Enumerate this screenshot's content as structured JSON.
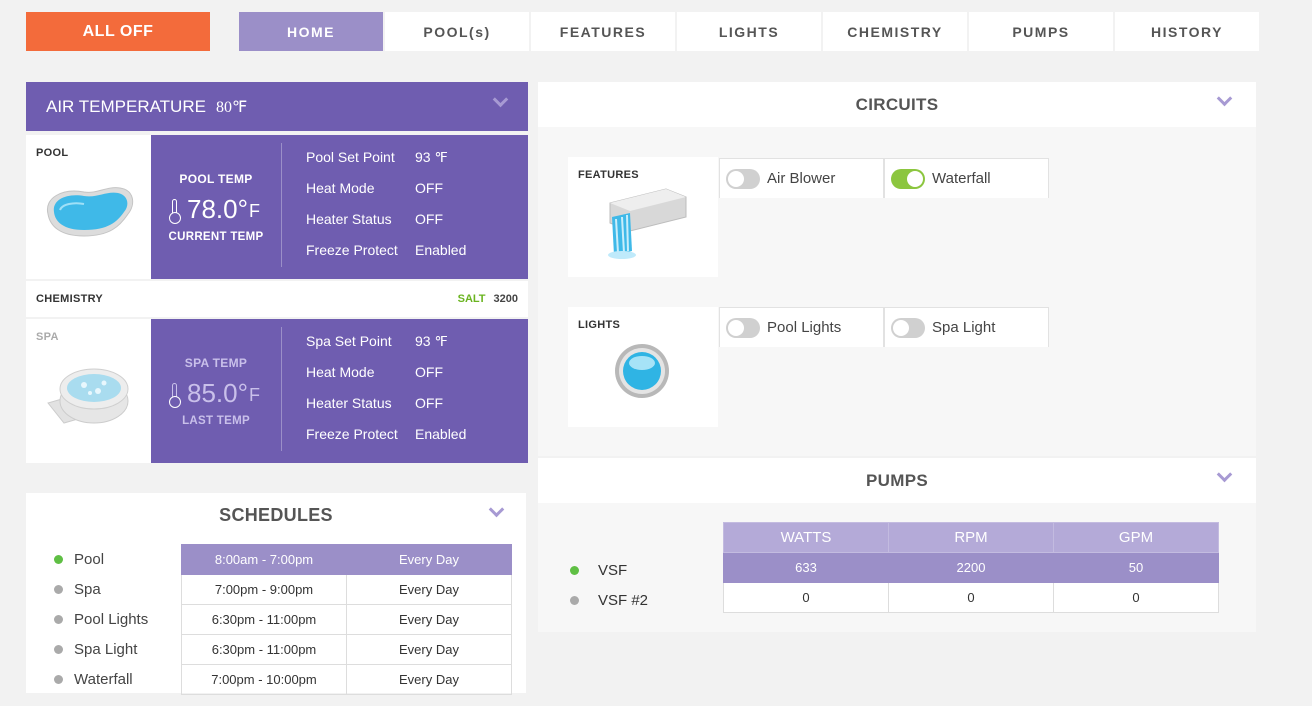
{
  "nav": {
    "all_off": "ALL OFF",
    "tabs": [
      "HOME",
      "POOL(s)",
      "FEATURES",
      "LIGHTS",
      "CHEMISTRY",
      "PUMPS",
      "HISTORY"
    ],
    "active_tab": "HOME"
  },
  "air": {
    "label": "AIR TEMPERATURE",
    "value": "80℉"
  },
  "pool": {
    "label": "POOL",
    "temp_head": "POOL TEMP",
    "temp_value": "78.0°",
    "temp_unit": "F",
    "temp_foot": "CURRENT TEMP",
    "rows": [
      {
        "k": "Pool Set Point",
        "v": "93 ℉"
      },
      {
        "k": "Heat Mode",
        "v": "OFF"
      },
      {
        "k": "Heater Status",
        "v": "OFF"
      },
      {
        "k": "Freeze Protect",
        "v": "Enabled"
      }
    ]
  },
  "chemistry": {
    "label": "CHEMISTRY",
    "salt_label": "SALT",
    "salt_value": "3200"
  },
  "spa": {
    "label": "SPA",
    "temp_head": "SPA TEMP",
    "temp_value": "85.0°",
    "temp_unit": "F",
    "temp_foot": "LAST TEMP",
    "rows": [
      {
        "k": "Spa Set Point",
        "v": "93 ℉"
      },
      {
        "k": "Heat Mode",
        "v": "OFF"
      },
      {
        "k": "Heater Status",
        "v": "OFF"
      },
      {
        "k": "Freeze Protect",
        "v": "Enabled"
      }
    ]
  },
  "schedules": {
    "title": "SCHEDULES",
    "items": [
      {
        "name": "Pool",
        "active": true,
        "time": "8:00am - 7:00pm",
        "days": "Every Day"
      },
      {
        "name": "Spa",
        "active": false,
        "time": "7:00pm - 9:00pm",
        "days": "Every Day"
      },
      {
        "name": "Pool Lights",
        "active": false,
        "time": "6:30pm - 11:00pm",
        "days": "Every Day"
      },
      {
        "name": "Spa Light",
        "active": false,
        "time": "6:30pm - 11:00pm",
        "days": "Every Day"
      },
      {
        "name": "Waterfall",
        "active": false,
        "time": "7:00pm - 10:00pm",
        "days": "Every Day"
      }
    ]
  },
  "circuits": {
    "title": "CIRCUITS",
    "features_label": "FEATURES",
    "features": [
      {
        "name": "Air Blower",
        "on": false
      },
      {
        "name": "Waterfall",
        "on": true
      }
    ],
    "lights_label": "LIGHTS",
    "lights": [
      {
        "name": "Pool Lights",
        "on": false
      },
      {
        "name": "Spa Light",
        "on": false
      }
    ]
  },
  "pumps": {
    "title": "PUMPS",
    "columns": [
      "WATTS",
      "RPM",
      "GPM"
    ],
    "rows": [
      {
        "name": "VSF",
        "active": true,
        "values": [
          "633",
          "2200",
          "50"
        ]
      },
      {
        "name": "VSF #2",
        "active": false,
        "values": [
          "0",
          "0",
          "0"
        ]
      }
    ]
  },
  "colors": {
    "accent": "#6f5db0",
    "tab_active": "#9b8fc8",
    "all_off": "#f36b3b",
    "toggle_on": "#8cc63f"
  }
}
